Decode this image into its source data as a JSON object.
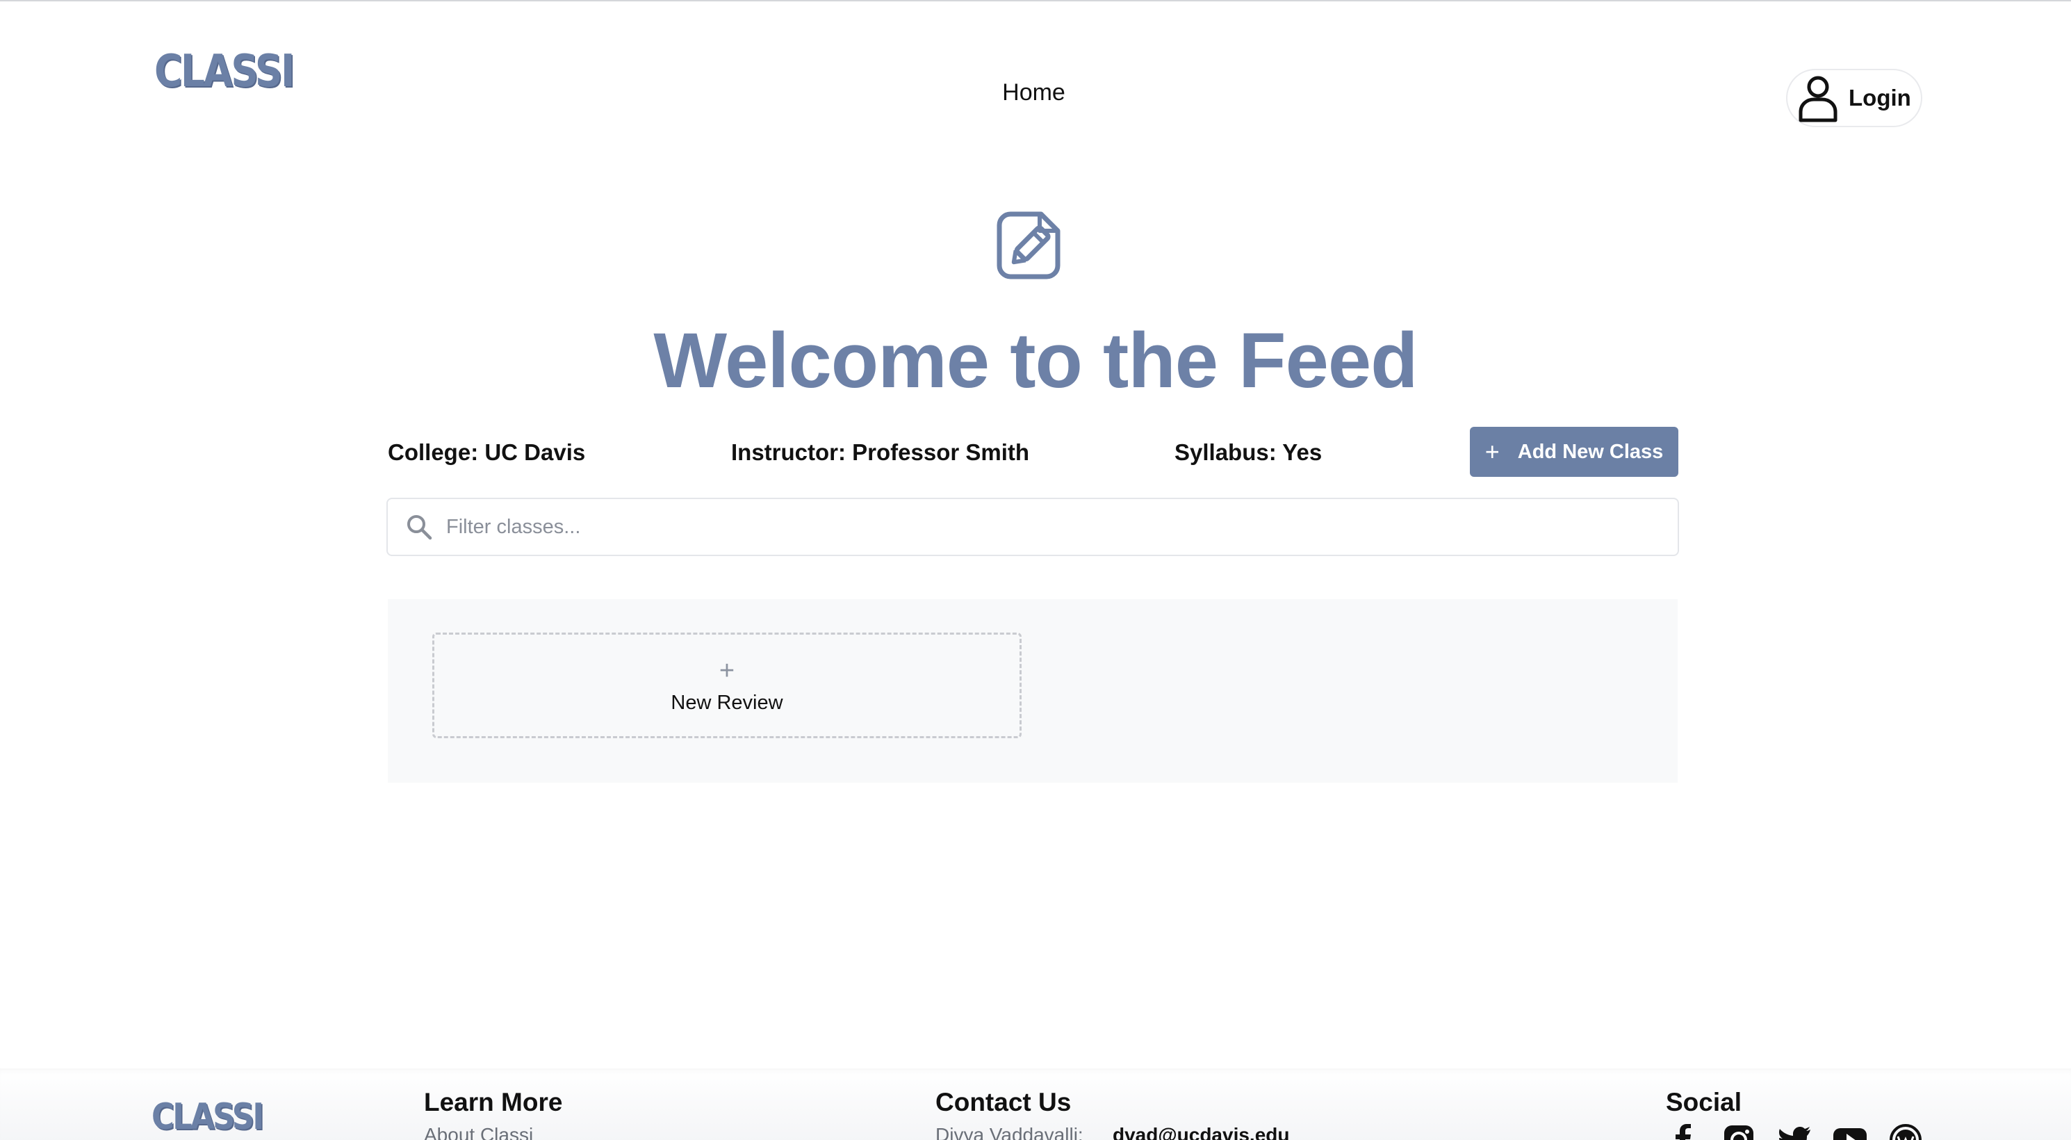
{
  "header": {
    "logo_text": "CLASSI",
    "nav": {
      "home_label": "Home"
    },
    "login_label": "Login"
  },
  "hero": {
    "icon": "pencil-note-icon",
    "title": "Welcome to the Feed"
  },
  "filters": {
    "college": "College: UC Davis",
    "instructor": "Instructor: Professor Smith",
    "syllabus": "Syllabus: Yes",
    "add_class_plus": "+",
    "add_class_label": "Add New Class"
  },
  "search": {
    "placeholder": "Filter classes...",
    "value": ""
  },
  "feed": {
    "new_review_plus": "+",
    "new_review_label": "New Review"
  },
  "footer": {
    "logo_text": "CLASSI",
    "learn_more": {
      "heading": "Learn More",
      "links": [
        "About Classi"
      ]
    },
    "contact": {
      "heading": "Contact Us",
      "name": "Divya Vaddavalli:",
      "email": "dvad@ucdavis.edu"
    },
    "social": {
      "heading": "Social",
      "icons": [
        "facebook-icon",
        "instagram-icon",
        "twitter-icon",
        "youtube-icon",
        "wordpress-icon"
      ]
    }
  },
  "colors": {
    "brand": "#6b80a6",
    "button_bg": "#6b80a5",
    "panel_bg": "#f8f9fa"
  }
}
